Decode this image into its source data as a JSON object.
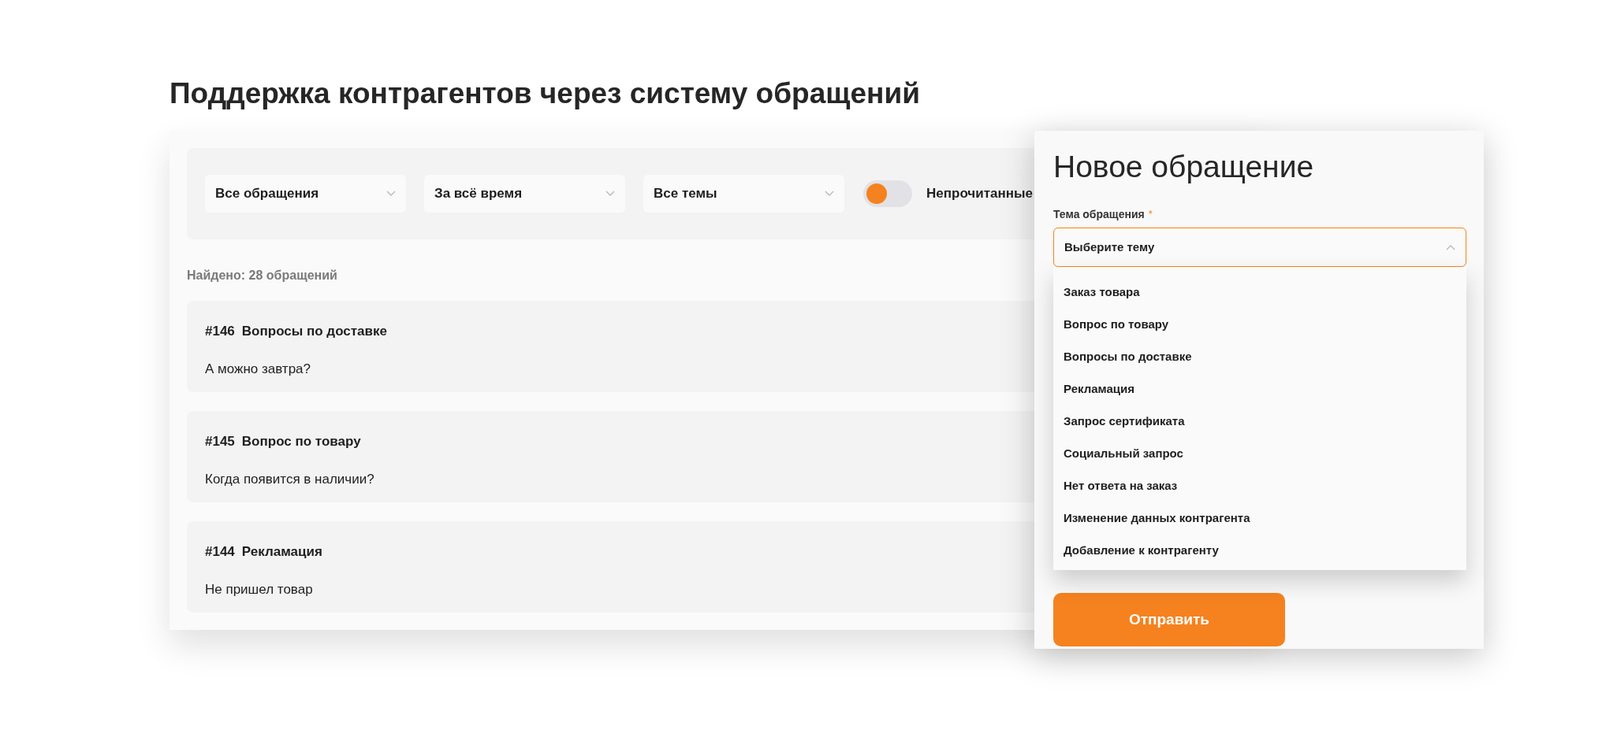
{
  "page_title": "Поддержка контрагентов через систему обращений",
  "filters": [
    {
      "value": "Все обращения"
    },
    {
      "value": "За всё время"
    },
    {
      "value": "Все темы"
    }
  ],
  "unread_toggle": {
    "label": "Непрочитанные",
    "on": false
  },
  "found_count": "Найдено: 28 обращений",
  "tickets": [
    {
      "number": "#146",
      "topic": "Вопросы по доставке",
      "message": "А можно завтра?"
    },
    {
      "number": "#145",
      "topic": "Вопрос по товару",
      "message": "Когда появится в наличии?"
    },
    {
      "number": "#144",
      "topic": "Рекламация",
      "message": "Не пришел товар"
    }
  ],
  "new_request": {
    "title": "Новое обращение",
    "field_label": "Тема обращения",
    "required_mark": "*",
    "placeholder": "Выберите тему",
    "expanded": true,
    "options": [
      "Заказ товара",
      "Вопрос по товару",
      "Вопросы по доставке",
      "Рекламация",
      "Запрос сертификата",
      "Социальный запрос",
      "Нет ответа на заказ",
      "Изменение данных контрагента",
      "Добавление к контрагенту"
    ],
    "submit": "Отправить"
  }
}
